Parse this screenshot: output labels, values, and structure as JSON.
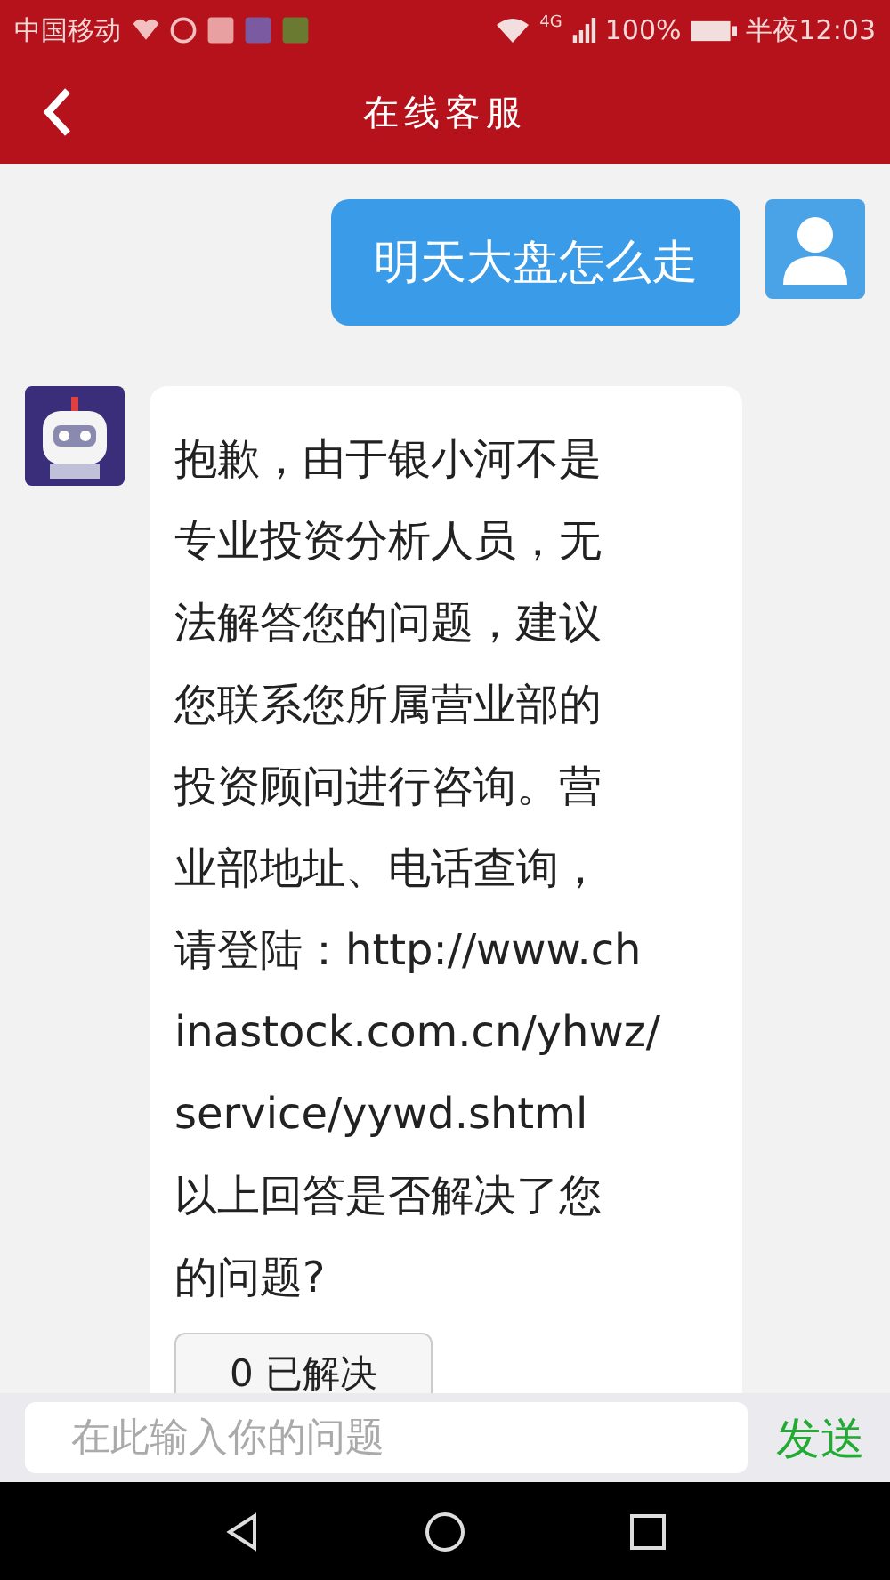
{
  "status_bar": {
    "carrier": "中国移动",
    "network": "4G",
    "battery": "100%",
    "time": "半夜12:03"
  },
  "header": {
    "title": "在线客服"
  },
  "messages": [
    {
      "kind": "user",
      "lines": [
        "明天大盘怎么走"
      ]
    },
    {
      "kind": "bot",
      "lines": [
        "抱歉，由于银小河不是",
        "专业投资分析人员，无",
        "法解答您的问题，建议",
        "您联系您所属营业部的",
        "投资顾问进行咨询。营",
        "业部地址、电话查询，",
        "请登陆：http://www.ch",
        "inastock.com.cn/yhwz/",
        "service/yywd.shtml",
        "以上回答是否解决了您",
        "的问题?"
      ],
      "button": "0 已解决"
    }
  ],
  "input": {
    "placeholder": "在此输入你的问题",
    "send": "发送"
  }
}
